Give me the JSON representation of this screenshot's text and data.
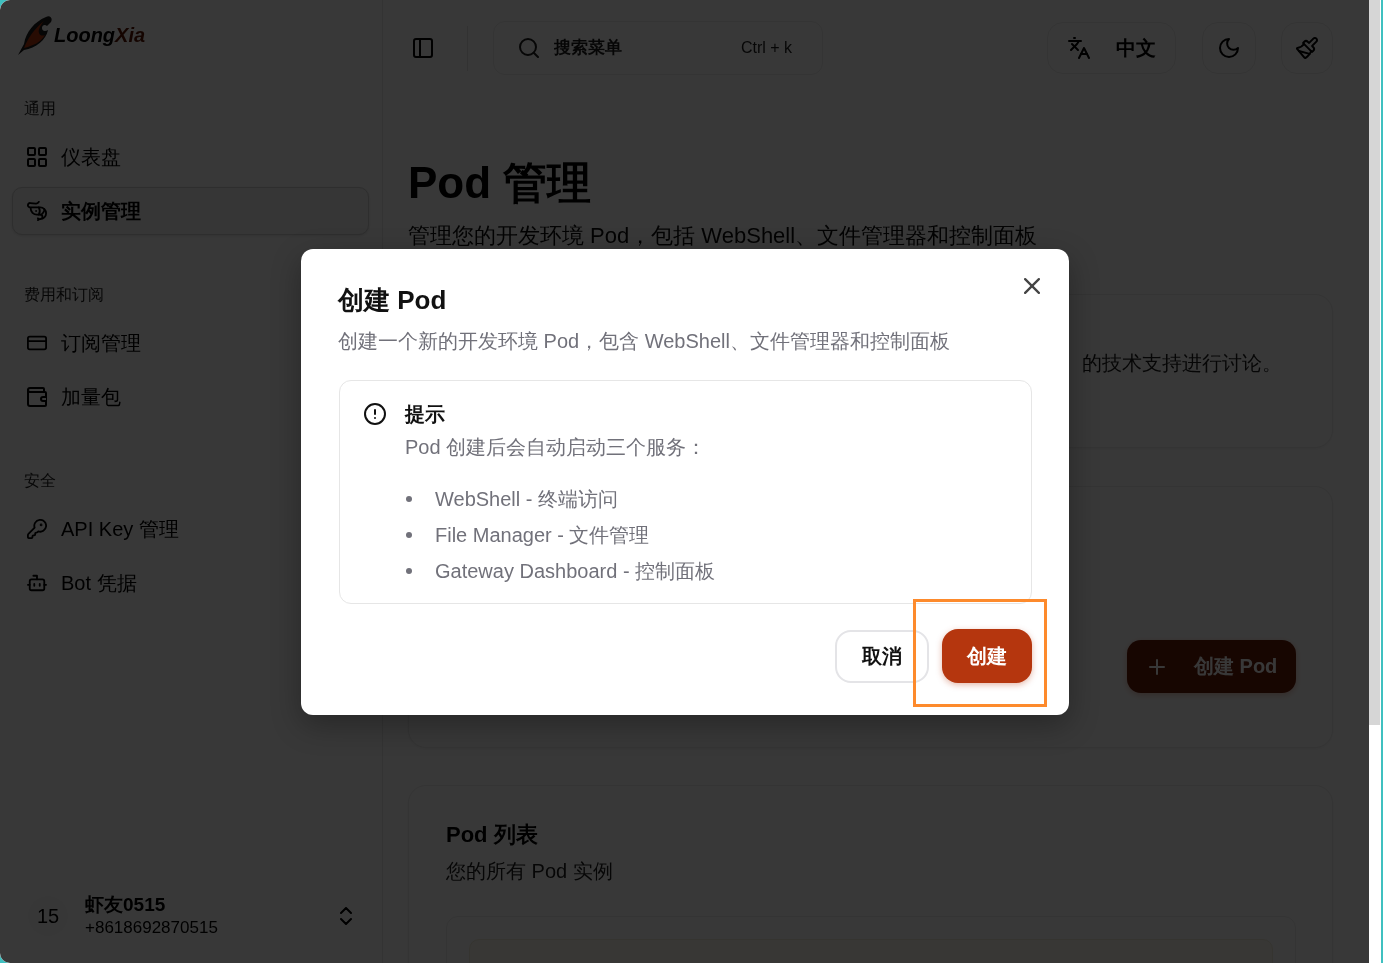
{
  "sidebar": {
    "logo": {
      "main": "Loong",
      "accent": "Xia"
    },
    "sections": [
      {
        "title": "通用",
        "items": [
          {
            "label": "仪表盘",
            "selected": false
          },
          {
            "label": "实例管理",
            "selected": true
          }
        ]
      },
      {
        "title": "费用和订阅",
        "items": [
          {
            "label": "订阅管理",
            "selected": false
          },
          {
            "label": "加量包",
            "selected": false
          }
        ]
      },
      {
        "title": "安全",
        "items": [
          {
            "label": "API Key 管理",
            "selected": false
          },
          {
            "label": "Bot 凭据",
            "selected": false
          }
        ]
      }
    ],
    "user": {
      "avatar": "15",
      "name": "虾友0515",
      "phone": "+8618692870515"
    }
  },
  "topbar": {
    "search": {
      "placeholder": "搜索菜单",
      "shortcut": "Ctrl + k"
    },
    "language": "中文"
  },
  "page": {
    "title": "Pod 管理",
    "subtitle": "管理您的开发环境 Pod，包括 WebShell、文件管理器和控制面板",
    "info_text": "的技术支持进行讨论。",
    "create_button": "创建 Pod",
    "list": {
      "title": "Pod 列表",
      "subtitle": "您的所有 Pod 实例"
    }
  },
  "dialog": {
    "title": "创建 Pod",
    "description": "创建一个新的开发环境 Pod，包含 WebShell、文件管理器和控制面板",
    "tip": {
      "title": "提示",
      "text": "Pod 创建后会自动启动三个服务：",
      "items": [
        "WebShell - 终端访问",
        "File Manager - 文件管理",
        "Gateway Dashboard - 控制面板"
      ]
    },
    "buttons": [
      {
        "label": "取消",
        "kind": "secondary",
        "highlighted": false
      },
      {
        "label": "创建",
        "kind": "primary",
        "highlighted": true
      }
    ]
  }
}
